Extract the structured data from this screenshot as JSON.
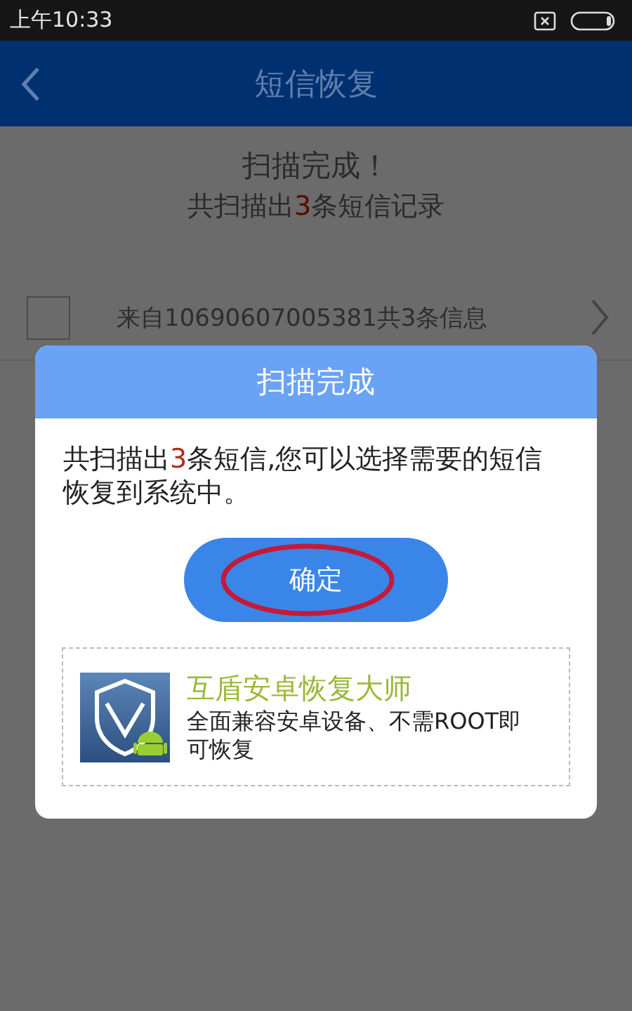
{
  "status_bar": {
    "time": "上午10:33"
  },
  "header": {
    "title": "短信恢复"
  },
  "summary": {
    "title": "扫描完成！",
    "count_line": {
      "before": "共扫描出",
      "count": "3",
      "after": "条短信记录"
    }
  },
  "messages": [
    {
      "label": "来自10690607005381共3条信息",
      "checked": false
    }
  ],
  "dialog": {
    "title": "扫描完成",
    "message": {
      "before": "共扫描出",
      "count": "3",
      "after": "条短信,您可以选择需要的短信恢复到系统中。"
    },
    "button": {
      "label": "确定",
      "circled": true
    },
    "promo": {
      "title": "互盾安卓恢复大师",
      "description": "全面兼容安卓设备、不需ROOT即可恢复"
    }
  }
}
